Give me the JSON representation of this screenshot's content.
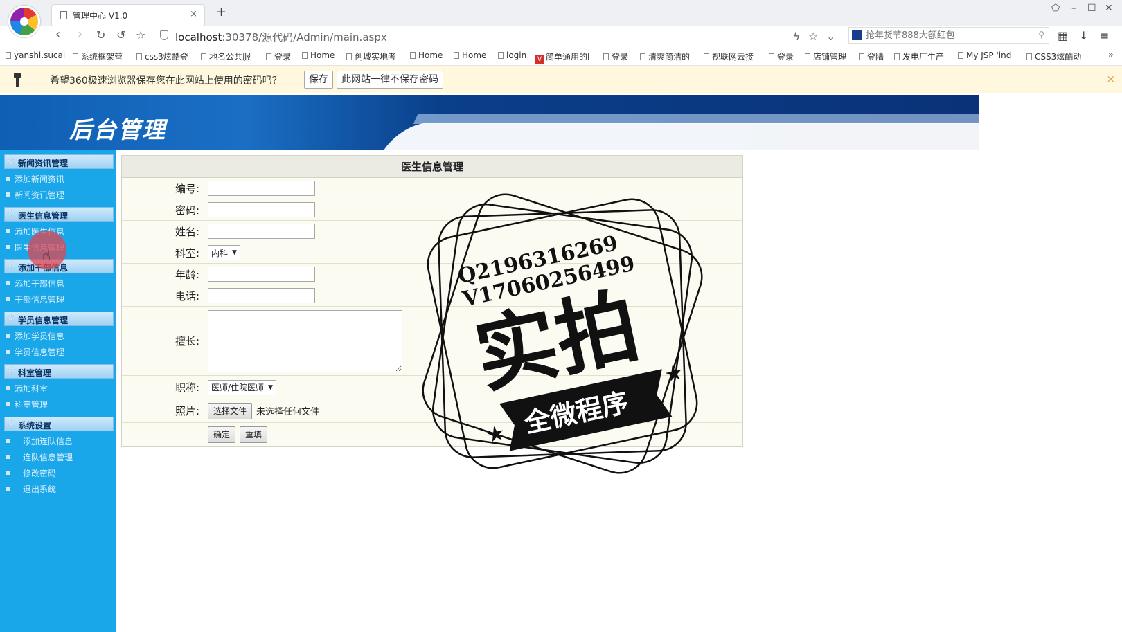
{
  "browser": {
    "tab_title": "管理中心 V1.0",
    "tab_close": "×",
    "new_tab": "+",
    "url_host": "localhost",
    "url_rest": ":30378/源代码/Admin/main.aspx",
    "search_placeholder": "抢年货节888大额红包",
    "bookmarks": [
      "yanshi.sucai",
      "系统框架营",
      "css3炫酷登",
      "地名公共服",
      "登录",
      "Home",
      "创城实地考",
      "Home",
      "Home",
      "login",
      "简单通用的l",
      "登录",
      "清爽简洁的",
      "视联网云接",
      "登录",
      "店铺管理",
      "登陆",
      "发电厂生产",
      "My JSP 'ind",
      "CSS3炫酷动"
    ],
    "bookmarks_more": "»"
  },
  "password_bar": {
    "message": "希望360极速浏览器保存您在此网站上使用的密码吗？",
    "save_label": "保存",
    "never_label": "此网站一律不保存密码",
    "close": "×"
  },
  "banner": {
    "title": "后台管理"
  },
  "sidebar": {
    "groups": [
      {
        "label": "新闻资讯管理",
        "items": [
          "添加新闻资讯",
          "新闻资讯管理"
        ]
      },
      {
        "label": "医生信息管理",
        "items": [
          "添加医生信息",
          "医生信息管理"
        ]
      },
      {
        "label": "添加干部信息",
        "items": [
          "添加干部信息",
          "干部信息管理"
        ]
      },
      {
        "label": "学员信息管理",
        "items": [
          "添加学员信息",
          "学员信息管理"
        ]
      },
      {
        "label": "科室管理",
        "items": [
          "添加科室",
          "科室管理"
        ]
      },
      {
        "label": "系统设置",
        "items": [
          "添加连队信息",
          "连队信息管理",
          "修改密码",
          "退出系统"
        ]
      }
    ]
  },
  "form": {
    "title": "医生信息管理",
    "labels": {
      "number": "编号:",
      "password": "密码:",
      "name": "姓名:",
      "department": "科室:",
      "age": "年龄:",
      "phone": "电话:",
      "specialty": "擅长:",
      "title": "职称:",
      "photo": "照片:"
    },
    "department_value": "内科",
    "title_value": "医师/住院医师",
    "choose_file": "选择文件",
    "no_file": "未选择任何文件",
    "submit": "确定",
    "reset": "重填"
  },
  "watermark": {
    "line1": "Q2196316269",
    "line2": "V17060256499",
    "big": "实拍",
    "ribbon": "全微程序"
  }
}
